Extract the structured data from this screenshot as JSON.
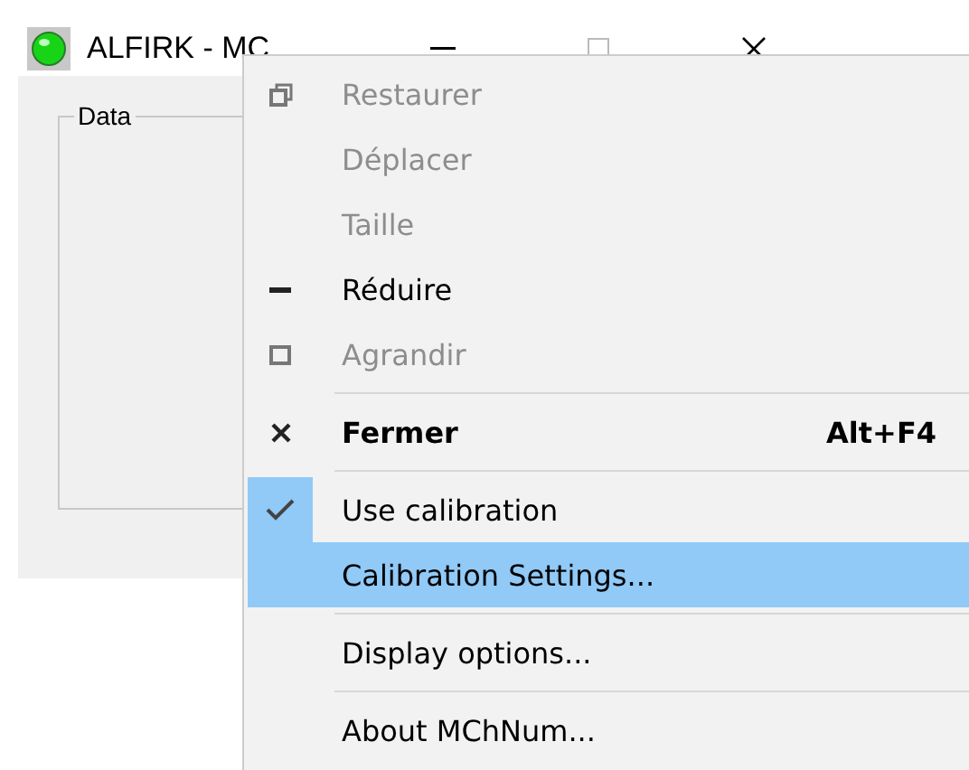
{
  "window": {
    "title": "ALFIRK - MC",
    "group": {
      "label": "Data"
    }
  },
  "context_menu": {
    "items": [
      {
        "kind": "restore",
        "label": "Restaurer",
        "disabled": true,
        "selected": false
      },
      {
        "kind": "plain",
        "label": "Déplacer",
        "disabled": true,
        "selected": false
      },
      {
        "kind": "plain",
        "label": "Taille",
        "disabled": true,
        "selected": false
      },
      {
        "kind": "minimize",
        "label": "Réduire",
        "disabled": false,
        "selected": false
      },
      {
        "kind": "maximize",
        "label": "Agrandir",
        "disabled": true,
        "selected": false
      },
      {
        "kind": "separator"
      },
      {
        "kind": "close",
        "label": "Fermer",
        "shortcut": "Alt+F4",
        "disabled": false,
        "default": true,
        "selected": false
      },
      {
        "kind": "separator"
      },
      {
        "kind": "toggle",
        "label": "Use calibration",
        "checked": true,
        "disabled": false,
        "selected": false
      },
      {
        "kind": "plain",
        "label": "Calibration Settings...",
        "disabled": false,
        "selected": true
      },
      {
        "kind": "separator"
      },
      {
        "kind": "plain",
        "label": "Display options...",
        "disabled": false,
        "selected": false
      },
      {
        "kind": "separator"
      },
      {
        "kind": "plain",
        "label": "About MChNum...",
        "disabled": false,
        "selected": false
      }
    ]
  }
}
